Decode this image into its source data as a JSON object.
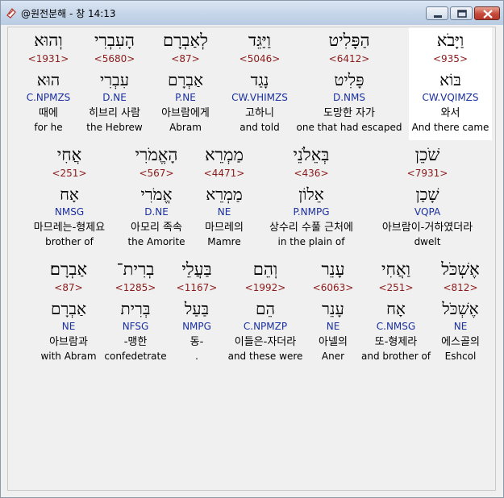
{
  "window": {
    "title": "@원전분해 - 창 14:13",
    "controls": {
      "minimize_icon": "minimize-icon",
      "maximize_icon": "maximize-icon",
      "close_icon": "close-icon"
    }
  },
  "rows": [
    {
      "words": [
        {
          "heb": "וַיָּבֹא",
          "strong": "<935>",
          "lemma": "בּוֹא",
          "morph": "CW.VQIMZS",
          "kor": "와서",
          "eng": "And there came"
        },
        {
          "heb": "הַפָּלִיט",
          "strong": "<6412>",
          "lemma": "פָּלִיט",
          "morph": "D.NMS",
          "kor": "도망한 자가",
          "eng": "one that had escaped"
        },
        {
          "heb": "וַיַּגֵּד",
          "strong": "<5046>",
          "lemma": "נָגַד",
          "morph": "CW.VHIMZS",
          "kor": "고하니",
          "eng": "and told"
        },
        {
          "heb": "לְאַבְרָם",
          "strong": "<87>",
          "lemma": "אַבְרָם",
          "morph": "P.NE",
          "kor": "아브람에게",
          "eng": "Abram"
        },
        {
          "heb": "הָעִבְרִי",
          "strong": "<5680>",
          "lemma": "עִבְרִי",
          "morph": "D.NE",
          "kor": "히브리 사람",
          "eng": "the Hebrew"
        },
        {
          "heb": "וְהוּא",
          "strong": "<1931>",
          "lemma": "הוּא",
          "morph": "C.NPMZS",
          "kor": "때에",
          "eng": "for he"
        }
      ]
    },
    {
      "words": [
        {
          "heb": "שֹׁכֵן",
          "strong": "<7931>",
          "lemma": "שָׁכַן",
          "morph": "VQPA",
          "kor": "아브람이-거하였더라",
          "eng": "dwelt"
        },
        {
          "heb": "בְּאֵלֹנֵי",
          "strong": "<436>",
          "lemma": "אֵלוֹן",
          "morph": "P.NMPG",
          "kor": "상수리 수풀 근처에",
          "eng": "in the plain of"
        },
        {
          "heb": "מַמְרֵא",
          "strong": "<4471>",
          "lemma": "מַמְרֵא",
          "morph": "NE",
          "kor": "마므레의",
          "eng": "Mamre"
        },
        {
          "heb": "הָאֱמֹרִי",
          "strong": "<567>",
          "lemma": "אֱמֹרִי",
          "morph": "D.NE",
          "kor": "아모리 족속",
          "eng": "the Amorite"
        },
        {
          "heb": "אֲחִי",
          "strong": "<251>",
          "lemma": "אָח",
          "morph": "NMSG",
          "kor": "마므레는-형제요",
          "eng": "brother of"
        }
      ]
    },
    {
      "words": [
        {
          "heb": "אֶשְׁכֹּל",
          "strong": "<812>",
          "lemma": "אֶשְׁכֹּל",
          "morph": "NE",
          "kor": "에스골의",
          "eng": "Eshcol"
        },
        {
          "heb": "וַאֲחִי",
          "strong": "<251>",
          "lemma": "אָח",
          "morph": "C.NMSG",
          "kor": "또-형제라",
          "eng": "and brother of"
        },
        {
          "heb": "עָנֵר",
          "strong": "<6063>",
          "lemma": "עָנֵר",
          "morph": "NE",
          "kor": "아넬의",
          "eng": "Aner"
        },
        {
          "heb": "וְהֵם",
          "strong": "<1992>",
          "lemma": "הֵם",
          "morph": "C.NPMZP",
          "kor": "이들은-자더라",
          "eng": "and these were"
        },
        {
          "heb": "בַּעֲלֵי",
          "strong": "<1167>",
          "lemma": "בַּעַל",
          "morph": "NMPG",
          "kor": "동-",
          "eng": "."
        },
        {
          "heb": "בְרִית־",
          "strong": "<1285>",
          "lemma": "בְּרִית",
          "morph": "NFSG",
          "kor": "-맹한",
          "eng": "confedetrate"
        },
        {
          "heb": "אַבְרָם׃",
          "strong": "<87>",
          "lemma": "אַבְרָם",
          "morph": "NE",
          "kor": "아브람과",
          "eng": "with Abram"
        }
      ]
    }
  ]
}
